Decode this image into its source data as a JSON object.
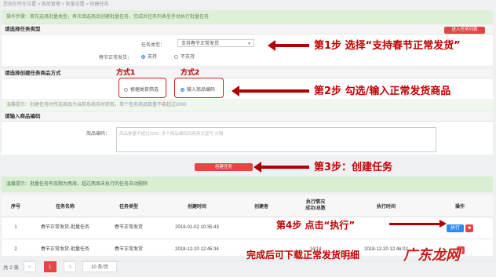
{
  "breadcrumb": "您现在所在位置 > 商品管理 > 批量设置 > 创建任务",
  "notice_top": "操作步骤：首先选择批量类型，再次填选商品创建批量任务，完成后任务列表里手动执行批量任务",
  "section_task_type": "请选择任务类型",
  "into_task_list_button": "进入任务列表",
  "task_type": {
    "label": "任务类型：",
    "value": "支持春节正常发货",
    "chevron_icon": "chevron-down-icon"
  },
  "spring_shipping": {
    "label": "春节正常发货：",
    "option_yes": "支持",
    "option_no": "不支持",
    "selected": "支持"
  },
  "section_method": "请选择创建任务商品方式",
  "method_options": {
    "by_category": "根据类目筛选",
    "input_code": "输入商品编码",
    "selected": "输入商品编码"
  },
  "method_tip": "温馨提示：创建任务时所选商品为当前系统实时获取，单个任务商品数量不能超过2000",
  "section_input": "请输入商品编码",
  "code_field": {
    "label": "商品编码：",
    "placeholder": "商品数量不超过2000 ,多个商品编码间用英文逗号,分隔"
  },
  "create_task_button": "创建任务",
  "expire_tip": "温馨提示：批量任务有效期为两周，超过两周未执行的任务自动删除",
  "table": {
    "columns": [
      "序号",
      "任务名称",
      "任务类型",
      "创建时间",
      "创建者",
      "执行情况\n成功/总数",
      "执行时间",
      "操作"
    ],
    "rows": [
      {
        "no": "1",
        "name": "春节正常发货-批量任务",
        "type": "春节正常发货",
        "created": "2019-01-02 10:35:43",
        "creator": "",
        "status": "",
        "exec_time": ""
      },
      {
        "no": "2",
        "name": "春节正常发货-批量任务",
        "type": "春节正常发货",
        "created": "2018-12-20 12:45:34",
        "creator": "",
        "status": "14/14",
        "exec_time": "2018-12-20 12:46:02"
      }
    ],
    "exec_label": "执行",
    "delete_icon": "trash-icon"
  },
  "pagination": {
    "total": "共 2 条",
    "prev": "<",
    "current": "1",
    "next": ">",
    "page_size": "10 条/页"
  },
  "annotations": {
    "step1": "第1步   选择“支持春节正常发货”",
    "step2": "第2步   勾选/输入正常发货商品",
    "step3": "第3步：创建任务",
    "step4": "第4步   点击“执行”",
    "done": "完成后可下载正常发货明细",
    "method1": "方式1",
    "method2": "方式2",
    "watermark": "广东龙网"
  }
}
